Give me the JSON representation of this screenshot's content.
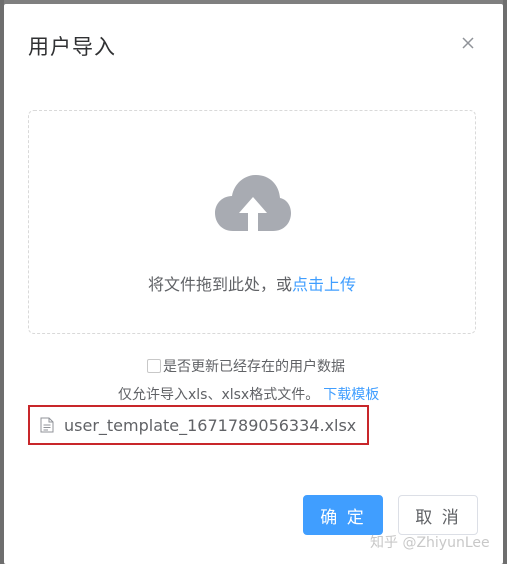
{
  "dialog": {
    "title": "用户导入",
    "close_icon": "close-icon"
  },
  "upload": {
    "icon": "cloud-upload-icon",
    "drop_text": "将文件拖到此处，或",
    "click_upload_link": "点击上传"
  },
  "update_checkbox": {
    "checked": false,
    "label": "是否更新已经存在的用户数据"
  },
  "tip": {
    "text": "仅允许导入xls、xlsx格式文件。",
    "download_link": "下载模板"
  },
  "file_list": [
    {
      "icon": "document-icon",
      "name": "user_template_1671789056334.xlsx"
    }
  ],
  "footer": {
    "confirm_label": "确 定",
    "cancel_label": "取 消"
  },
  "watermark": "知乎 @ZhiyunLee",
  "colors": {
    "primary": "#409eff",
    "highlight_border": "#c8262a",
    "icon_gray": "#a8abb2"
  }
}
